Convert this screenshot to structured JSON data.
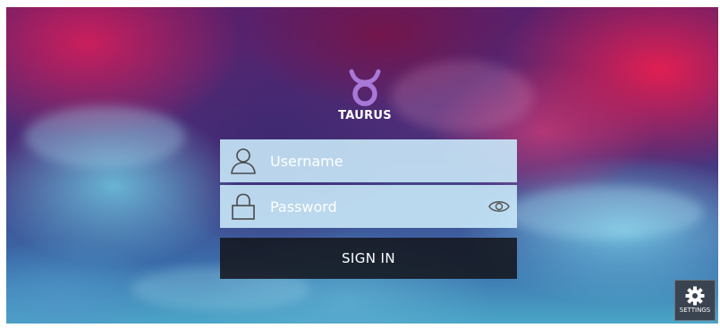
{
  "app": {
    "brand_name": "TAURUS",
    "logo_icon": "taurus-symbol-icon",
    "logo_color": "#a878d8"
  },
  "login": {
    "username_placeholder": "Username",
    "username_value": "",
    "password_placeholder": "Password",
    "password_value": "",
    "signin_label": "SIGN IN",
    "field_background": "#c8e8f8",
    "button_background": "#14161e"
  },
  "settings": {
    "label": "SETTINGS",
    "icon": "gear-icon"
  }
}
